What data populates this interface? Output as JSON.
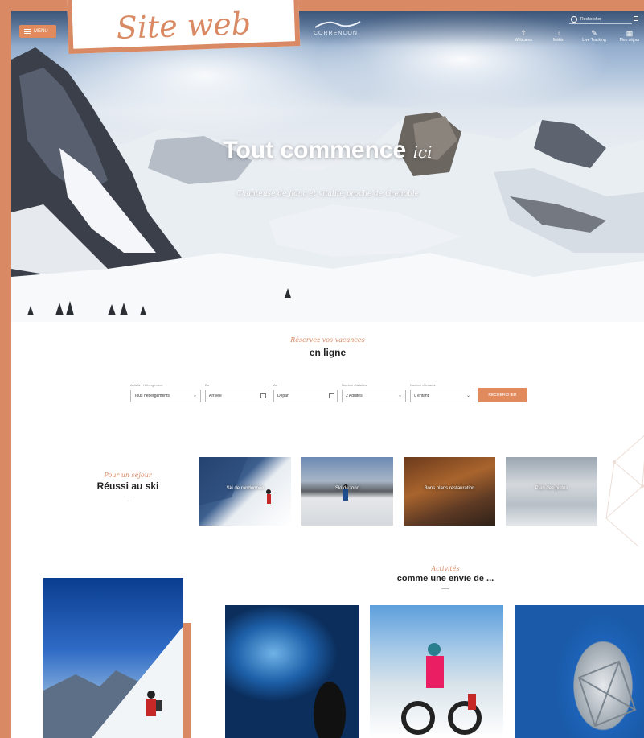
{
  "badge": {
    "label": "Site web"
  },
  "header": {
    "menu_label": "MENU",
    "logo_text": "CORRENCON",
    "search_placeholder": "Rechercher",
    "nav": [
      {
        "label": "Webcams",
        "icon": "camera-icon",
        "glyph": "⇧"
      },
      {
        "label": "Météo",
        "icon": "weather-icon",
        "glyph": "⁝"
      },
      {
        "label": "Live Tracking",
        "icon": "tracking-icon",
        "glyph": "✎"
      },
      {
        "label": "Mon séjour",
        "icon": "calendar-icon",
        "glyph": "▦"
      }
    ]
  },
  "hero": {
    "title_main": "Tout commence",
    "title_script": "ici",
    "subtitle": "Chanteuse de flanc et vitalité proche de Grenoble"
  },
  "booking": {
    "kicker": "Réservez vos vacances",
    "title": "en ligne",
    "fields": [
      {
        "label": "Activité / Hébergement",
        "value": "Tous hébergements"
      },
      {
        "label": "Du",
        "value": "Arrivée"
      },
      {
        "label": "Au",
        "value": "Départ"
      },
      {
        "label": "Nombre d'adultes",
        "value": "2 Adultes"
      },
      {
        "label": "Nombre d'enfants",
        "value": "0 enfant"
      }
    ],
    "submit": "RECHERCHER"
  },
  "reussi": {
    "kicker": "Pour un séjour",
    "title": "Réussi au ski"
  },
  "cards": [
    {
      "label": "Ski de randonnée"
    },
    {
      "label": "Ski de fond"
    },
    {
      "label": "Bons plans restauration"
    },
    {
      "label": "Plan des pistes"
    }
  ],
  "envie": {
    "kicker": "Activités",
    "title": "comme une envie de ..."
  }
}
